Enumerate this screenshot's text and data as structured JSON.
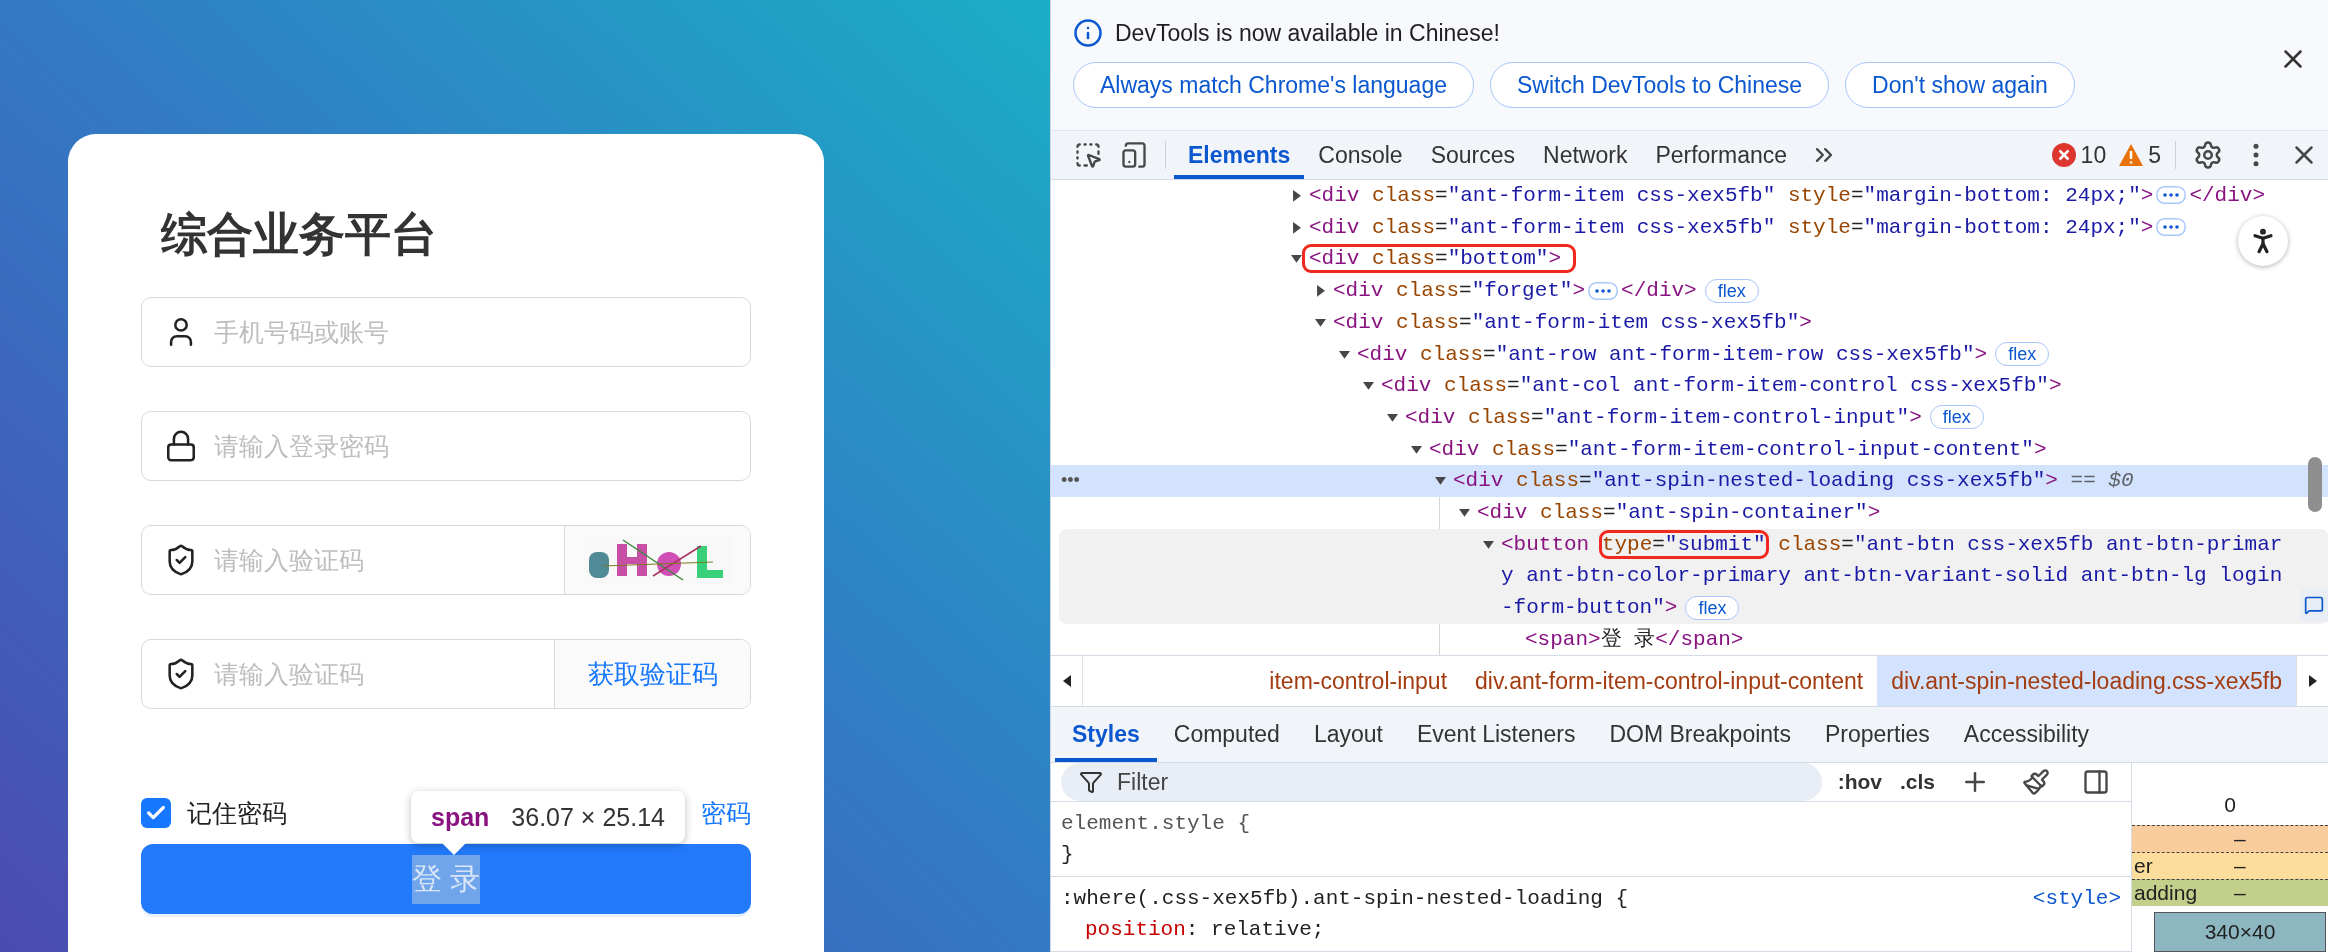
{
  "login_page": {
    "title": "综合业务平台",
    "fields": [
      {
        "kind": "account",
        "placeholder": "手机号码或账号"
      },
      {
        "kind": "password",
        "placeholder": "请输入登录密码"
      },
      {
        "kind": "captcha",
        "placeholder": "请输入验证码"
      },
      {
        "kind": "sms",
        "placeholder": "请输入验证码",
        "addon_label": "获取验证码"
      }
    ],
    "remember": {
      "label": "记住密码",
      "checked": true
    },
    "forgot_link": "密码",
    "submit": {
      "label": "登 录",
      "inspected": true
    },
    "inspect_tooltip": {
      "tag": "span",
      "size": "36.07 × 25.14"
    }
  },
  "devtools": {
    "language_banner": {
      "message": "DevTools is now available in Chinese!",
      "buttons": [
        "Always match Chrome's language",
        "Switch DevTools to Chinese",
        "Don't show again"
      ]
    },
    "tabs": [
      {
        "label": "Elements",
        "selected": true
      },
      {
        "label": "Console",
        "selected": false
      },
      {
        "label": "Sources",
        "selected": false
      },
      {
        "label": "Network",
        "selected": false
      },
      {
        "label": "Performance",
        "selected": false
      }
    ],
    "errors": "10",
    "warnings": "5",
    "dom_tree": [
      {
        "line": "<div class=\"ant-form-item css-xex5fb\" style=\"margin-bottom: 24px;\">",
        "expanded": false,
        "closing": "</div>",
        "selected": false,
        "hovered": false
      },
      {
        "line": "<div class=\"ant-form-item css-xex5fb\" style=\"margin-bottom: 24px;\">",
        "expanded": false,
        "selected": false,
        "hovered": false
      },
      {
        "line": "<div class=\"bottom\">",
        "expanded": true,
        "selected": false,
        "hovered": false,
        "outlined": true,
        "children": [
          {
            "line": "<div class=\"forget\">",
            "expanded": false,
            "closing": "</div>",
            "badge": "flex",
            "selected": false,
            "hovered": false
          },
          {
            "line": "<div class=\"ant-form-item css-xex5fb\">",
            "expanded": true,
            "selected": false,
            "hovered": false,
            "children": [
              {
                "line": "<div class=\"ant-row ant-form-item-row css-xex5fb\">",
                "expanded": true,
                "badge": "flex",
                "selected": false,
                "hovered": false,
                "children": [
                  {
                    "line": "<div class=\"ant-col ant-form-item-control css-xex5fb\">",
                    "expanded": true,
                    "selected": false,
                    "hovered": false,
                    "children": [
                      {
                        "line": "<div class=\"ant-form-item-control-input\">",
                        "expanded": true,
                        "badge": "flex",
                        "selected": false,
                        "hovered": false,
                        "children": [
                          {
                            "line": "<div class=\"ant-form-item-control-input-content\">",
                            "expanded": true,
                            "selected": false,
                            "hovered": false,
                            "children": [
                              {
                                "line": "<div class=\"ant-spin-nested-loading css-xex5fb\">",
                                "expanded": true,
                                "selected": true,
                                "hovered": false,
                                "gutter": "•••",
                                "suffix": "== $0",
                                "children": [
                                  {
                                    "line": "<div class=\"ant-spin-container\">",
                                    "expanded": true,
                                    "selected": false,
                                    "hovered": false,
                                    "children": [
                                      {
                                        "line": "<button",
                                        "outlined_attr": "type=\"submit\"",
                                        "line_end": "class=\"ant-btn css-xex5fb ant-btn-primary ant-btn-color-primary ant-btn-variant-solid ant-btn-lg login-form-button\">",
                                        "expanded": true,
                                        "badge": "flex",
                                        "selected": false,
                                        "hovered": true,
                                        "children": [
                                          {
                                            "line": "<span>登 录</span>",
                                            "selected": false,
                                            "hovered": false
                                          }
                                        ]
                                      }
                                    ]
                                  }
                                ]
                              }
                            ]
                          }
                        ]
                      }
                    ]
                  }
                ]
              }
            ]
          }
        ]
      }
    ],
    "breadcrumbs": [
      {
        "label": "item-control-input",
        "selected": false
      },
      {
        "label": "div.ant-form-item-control-input-content",
        "selected": false
      },
      {
        "label": "div.ant-spin-nested-loading.css-xex5fb",
        "selected": true
      }
    ],
    "sidebar_tabs": [
      {
        "label": "Styles",
        "selected": true
      },
      {
        "label": "Computed",
        "selected": false
      },
      {
        "label": "Layout",
        "selected": false
      },
      {
        "label": "Event Listeners",
        "selected": false
      },
      {
        "label": "DOM Breakpoints",
        "selected": false
      },
      {
        "label": "Properties",
        "selected": false
      },
      {
        "label": "Accessibility",
        "selected": false
      }
    ],
    "filter": {
      "placeholder": "Filter"
    },
    "filter_tools": [
      ":hov",
      ".cls"
    ],
    "rules": [
      {
        "selector": "element.style {",
        "closing": "}"
      },
      {
        "selector": ":where(.css-xex5fb).ant-spin-nested-loading {",
        "source": "<style>",
        "declarations": [
          {
            "property": "position",
            "separator": ":",
            "value": "relative;"
          }
        ]
      }
    ],
    "box_model": {
      "top_value": "0",
      "layers": [
        {
          "kind": "margin",
          "value": "–"
        },
        {
          "kind": "border",
          "label": "er",
          "value": "–"
        },
        {
          "kind": "padding",
          "label": "adding",
          "value": "–"
        }
      ],
      "content": "340×40"
    }
  }
}
